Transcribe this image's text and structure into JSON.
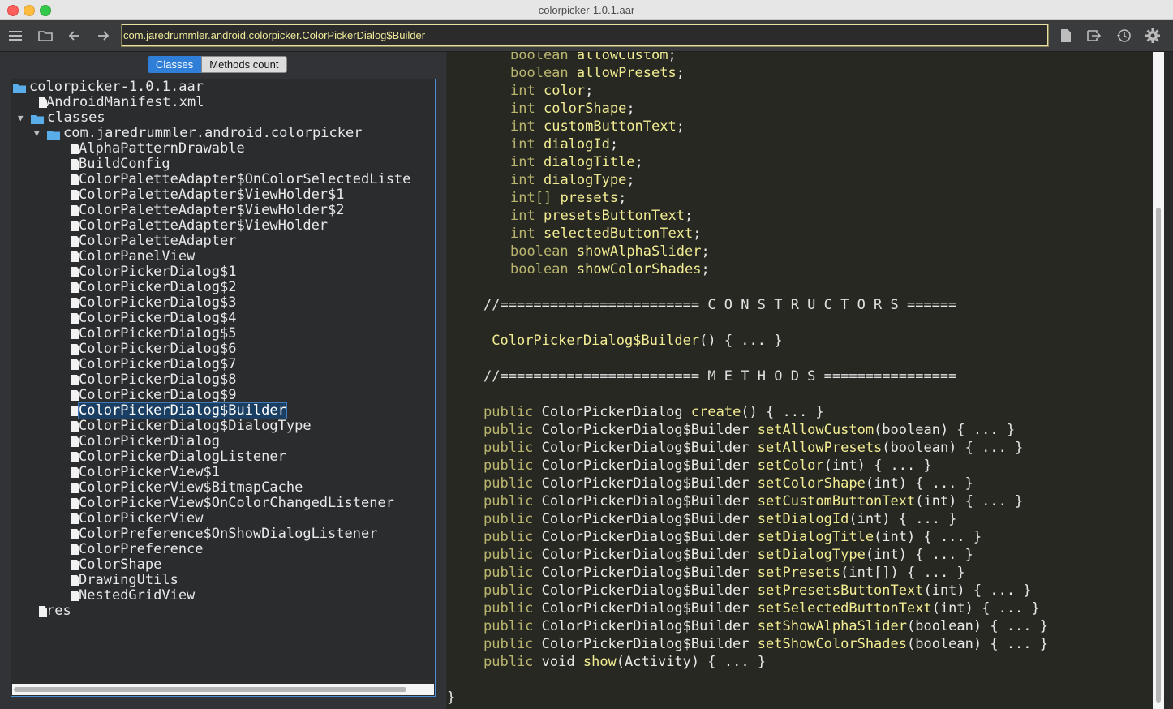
{
  "window": {
    "title": "colorpicker-1.0.1.aar"
  },
  "toolbar": {
    "address": "com.jaredrummler.android.colorpicker.ColorPickerDialog$Builder"
  },
  "tabs": {
    "classes": "Classes",
    "methods_count": "Methods count"
  },
  "tree": [
    {
      "label": "colorpicker-1.0.1.aar",
      "depth": 0,
      "kind": "folder",
      "arrow": ""
    },
    {
      "label": "AndroidManifest.xml",
      "depth": 1,
      "kind": "file",
      "arrow": ""
    },
    {
      "label": "classes",
      "depth": 1,
      "kind": "folder",
      "arrow": "▼"
    },
    {
      "label": "com.jaredrummler.android.colorpicker",
      "depth": 2,
      "kind": "folder",
      "arrow": "▼"
    },
    {
      "label": "AlphaPatternDrawable",
      "depth": 3,
      "kind": "file",
      "arrow": ""
    },
    {
      "label": "BuildConfig",
      "depth": 3,
      "kind": "file",
      "arrow": ""
    },
    {
      "label": "ColorPaletteAdapter$OnColorSelectedListe",
      "depth": 3,
      "kind": "file",
      "arrow": ""
    },
    {
      "label": "ColorPaletteAdapter$ViewHolder$1",
      "depth": 3,
      "kind": "file",
      "arrow": ""
    },
    {
      "label": "ColorPaletteAdapter$ViewHolder$2",
      "depth": 3,
      "kind": "file",
      "arrow": ""
    },
    {
      "label": "ColorPaletteAdapter$ViewHolder",
      "depth": 3,
      "kind": "file",
      "arrow": ""
    },
    {
      "label": "ColorPaletteAdapter",
      "depth": 3,
      "kind": "file",
      "arrow": ""
    },
    {
      "label": "ColorPanelView",
      "depth": 3,
      "kind": "file",
      "arrow": ""
    },
    {
      "label": "ColorPickerDialog$1",
      "depth": 3,
      "kind": "file",
      "arrow": ""
    },
    {
      "label": "ColorPickerDialog$2",
      "depth": 3,
      "kind": "file",
      "arrow": ""
    },
    {
      "label": "ColorPickerDialog$3",
      "depth": 3,
      "kind": "file",
      "arrow": ""
    },
    {
      "label": "ColorPickerDialog$4",
      "depth": 3,
      "kind": "file",
      "arrow": ""
    },
    {
      "label": "ColorPickerDialog$5",
      "depth": 3,
      "kind": "file",
      "arrow": ""
    },
    {
      "label": "ColorPickerDialog$6",
      "depth": 3,
      "kind": "file",
      "arrow": ""
    },
    {
      "label": "ColorPickerDialog$7",
      "depth": 3,
      "kind": "file",
      "arrow": ""
    },
    {
      "label": "ColorPickerDialog$8",
      "depth": 3,
      "kind": "file",
      "arrow": ""
    },
    {
      "label": "ColorPickerDialog$9",
      "depth": 3,
      "kind": "file",
      "arrow": ""
    },
    {
      "label": "ColorPickerDialog$Builder",
      "depth": 3,
      "kind": "file",
      "arrow": "",
      "selected": true
    },
    {
      "label": "ColorPickerDialog$DialogType",
      "depth": 3,
      "kind": "file",
      "arrow": ""
    },
    {
      "label": "ColorPickerDialog",
      "depth": 3,
      "kind": "file",
      "arrow": ""
    },
    {
      "label": "ColorPickerDialogListener",
      "depth": 3,
      "kind": "file",
      "arrow": ""
    },
    {
      "label": "ColorPickerView$1",
      "depth": 3,
      "kind": "file",
      "arrow": ""
    },
    {
      "label": "ColorPickerView$BitmapCache",
      "depth": 3,
      "kind": "file",
      "arrow": ""
    },
    {
      "label": "ColorPickerView$OnColorChangedListener",
      "depth": 3,
      "kind": "file",
      "arrow": ""
    },
    {
      "label": "ColorPickerView",
      "depth": 3,
      "kind": "file",
      "arrow": ""
    },
    {
      "label": "ColorPreference$OnShowDialogListener",
      "depth": 3,
      "kind": "file",
      "arrow": ""
    },
    {
      "label": "ColorPreference",
      "depth": 3,
      "kind": "file",
      "arrow": ""
    },
    {
      "label": "ColorShape",
      "depth": 3,
      "kind": "file",
      "arrow": ""
    },
    {
      "label": "DrawingUtils",
      "depth": 3,
      "kind": "file",
      "arrow": ""
    },
    {
      "label": "NestedGridView",
      "depth": 3,
      "kind": "file",
      "arrow": ""
    },
    {
      "label": "res",
      "depth": 1,
      "kind": "file",
      "arrow": ""
    }
  ],
  "code": [
    {
      "indent": 4,
      "parts": [
        [
          "kw",
          "boolean"
        ],
        [
          "tx",
          " "
        ],
        [
          "id",
          "allowCustom"
        ],
        [
          "tx",
          ";"
        ]
      ]
    },
    {
      "indent": 4,
      "parts": [
        [
          "kw",
          "boolean"
        ],
        [
          "tx",
          " "
        ],
        [
          "id",
          "allowPresets"
        ],
        [
          "tx",
          ";"
        ]
      ]
    },
    {
      "indent": 4,
      "parts": [
        [
          "kw",
          "int"
        ],
        [
          "tx",
          " "
        ],
        [
          "id",
          "color"
        ],
        [
          "tx",
          ";"
        ]
      ]
    },
    {
      "indent": 4,
      "parts": [
        [
          "kw",
          "int"
        ],
        [
          "tx",
          " "
        ],
        [
          "id",
          "colorShape"
        ],
        [
          "tx",
          ";"
        ]
      ]
    },
    {
      "indent": 4,
      "parts": [
        [
          "kw",
          "int"
        ],
        [
          "tx",
          " "
        ],
        [
          "id",
          "customButtonText"
        ],
        [
          "tx",
          ";"
        ]
      ]
    },
    {
      "indent": 4,
      "parts": [
        [
          "kw",
          "int"
        ],
        [
          "tx",
          " "
        ],
        [
          "id",
          "dialogId"
        ],
        [
          "tx",
          ";"
        ]
      ]
    },
    {
      "indent": 4,
      "parts": [
        [
          "kw",
          "int"
        ],
        [
          "tx",
          " "
        ],
        [
          "id",
          "dialogTitle"
        ],
        [
          "tx",
          ";"
        ]
      ]
    },
    {
      "indent": 4,
      "parts": [
        [
          "kw",
          "int"
        ],
        [
          "tx",
          " "
        ],
        [
          "id",
          "dialogType"
        ],
        [
          "tx",
          ";"
        ]
      ]
    },
    {
      "indent": 4,
      "parts": [
        [
          "kw",
          "int[]"
        ],
        [
          "tx",
          " "
        ],
        [
          "id",
          "presets"
        ],
        [
          "tx",
          ";"
        ]
      ]
    },
    {
      "indent": 4,
      "parts": [
        [
          "kw",
          "int"
        ],
        [
          "tx",
          " "
        ],
        [
          "id",
          "presetsButtonText"
        ],
        [
          "tx",
          ";"
        ]
      ]
    },
    {
      "indent": 4,
      "parts": [
        [
          "kw",
          "int"
        ],
        [
          "tx",
          " "
        ],
        [
          "id",
          "selectedButtonText"
        ],
        [
          "tx",
          ";"
        ]
      ]
    },
    {
      "indent": 4,
      "parts": [
        [
          "kw",
          "boolean"
        ],
        [
          "tx",
          " "
        ],
        [
          "id",
          "showAlphaSlider"
        ],
        [
          "tx",
          ";"
        ]
      ]
    },
    {
      "indent": 4,
      "parts": [
        [
          "kw",
          "boolean"
        ],
        [
          "tx",
          " "
        ],
        [
          "id",
          "showColorShades"
        ],
        [
          "tx",
          ";"
        ]
      ]
    },
    {
      "indent": 0,
      "parts": []
    },
    {
      "indent": 1,
      "parts": [
        [
          "cm",
          "//======================== C O N S T R U C T O R S ======"
        ]
      ]
    },
    {
      "indent": 0,
      "parts": []
    },
    {
      "indent": 1,
      "parts": [
        [
          "tx",
          " "
        ],
        [
          "id",
          "ColorPickerDialog$Builder"
        ],
        [
          "tx",
          "() { ... }"
        ]
      ]
    },
    {
      "indent": 0,
      "parts": []
    },
    {
      "indent": 1,
      "parts": [
        [
          "cm",
          "//======================== M E T H O D S ================"
        ]
      ]
    },
    {
      "indent": 0,
      "parts": []
    },
    {
      "indent": 1,
      "parts": [
        [
          "kw",
          "public"
        ],
        [
          "tx",
          " ColorPickerDialog "
        ],
        [
          "id",
          "create"
        ],
        [
          "tx",
          "() { ... }"
        ]
      ]
    },
    {
      "indent": 1,
      "parts": [
        [
          "kw",
          "public"
        ],
        [
          "tx",
          " ColorPickerDialog$Builder "
        ],
        [
          "id",
          "setAllowCustom"
        ],
        [
          "tx",
          "(boolean) { ... }"
        ]
      ]
    },
    {
      "indent": 1,
      "parts": [
        [
          "kw",
          "public"
        ],
        [
          "tx",
          " ColorPickerDialog$Builder "
        ],
        [
          "id",
          "setAllowPresets"
        ],
        [
          "tx",
          "(boolean) { ... }"
        ]
      ]
    },
    {
      "indent": 1,
      "parts": [
        [
          "kw",
          "public"
        ],
        [
          "tx",
          " ColorPickerDialog$Builder "
        ],
        [
          "id",
          "setColor"
        ],
        [
          "tx",
          "(int) { ... }"
        ]
      ]
    },
    {
      "indent": 1,
      "parts": [
        [
          "kw",
          "public"
        ],
        [
          "tx",
          " ColorPickerDialog$Builder "
        ],
        [
          "id",
          "setColorShape"
        ],
        [
          "tx",
          "(int) { ... }"
        ]
      ]
    },
    {
      "indent": 1,
      "parts": [
        [
          "kw",
          "public"
        ],
        [
          "tx",
          " ColorPickerDialog$Builder "
        ],
        [
          "id",
          "setCustomButtonText"
        ],
        [
          "tx",
          "(int) { ... }"
        ]
      ]
    },
    {
      "indent": 1,
      "parts": [
        [
          "kw",
          "public"
        ],
        [
          "tx",
          " ColorPickerDialog$Builder "
        ],
        [
          "id",
          "setDialogId"
        ],
        [
          "tx",
          "(int) { ... }"
        ]
      ]
    },
    {
      "indent": 1,
      "parts": [
        [
          "kw",
          "public"
        ],
        [
          "tx",
          " ColorPickerDialog$Builder "
        ],
        [
          "id",
          "setDialogTitle"
        ],
        [
          "tx",
          "(int) { ... }"
        ]
      ]
    },
    {
      "indent": 1,
      "parts": [
        [
          "kw",
          "public"
        ],
        [
          "tx",
          " ColorPickerDialog$Builder "
        ],
        [
          "id",
          "setDialogType"
        ],
        [
          "tx",
          "(int) { ... }"
        ]
      ]
    },
    {
      "indent": 1,
      "parts": [
        [
          "kw",
          "public"
        ],
        [
          "tx",
          " ColorPickerDialog$Builder "
        ],
        [
          "id",
          "setPresets"
        ],
        [
          "tx",
          "(int[]) { ... }"
        ]
      ]
    },
    {
      "indent": 1,
      "parts": [
        [
          "kw",
          "public"
        ],
        [
          "tx",
          " ColorPickerDialog$Builder "
        ],
        [
          "id",
          "setPresetsButtonText"
        ],
        [
          "tx",
          "(int) { ... }"
        ]
      ]
    },
    {
      "indent": 1,
      "parts": [
        [
          "kw",
          "public"
        ],
        [
          "tx",
          " ColorPickerDialog$Builder "
        ],
        [
          "id",
          "setSelectedButtonText"
        ],
        [
          "tx",
          "(int) { ... }"
        ]
      ]
    },
    {
      "indent": 1,
      "parts": [
        [
          "kw",
          "public"
        ],
        [
          "tx",
          " ColorPickerDialog$Builder "
        ],
        [
          "id",
          "setShowAlphaSlider"
        ],
        [
          "tx",
          "(boolean) { ... }"
        ]
      ]
    },
    {
      "indent": 1,
      "parts": [
        [
          "kw",
          "public"
        ],
        [
          "tx",
          " ColorPickerDialog$Builder "
        ],
        [
          "id",
          "setShowColorShades"
        ],
        [
          "tx",
          "(boolean) { ... }"
        ]
      ]
    },
    {
      "indent": 1,
      "parts": [
        [
          "kw",
          "public"
        ],
        [
          "tx",
          " void "
        ],
        [
          "id",
          "show"
        ],
        [
          "tx",
          "(Activity) { ... }"
        ]
      ]
    },
    {
      "indent": 0,
      "parts": []
    },
    {
      "indent": 0,
      "parts": [
        [
          "tx",
          "}"
        ]
      ]
    }
  ],
  "icons": {
    "menu": "hamburger-icon",
    "open": "folder-icon",
    "back": "arrow-left-icon",
    "forward": "arrow-right-icon",
    "save": "document-icon",
    "export": "export-icon",
    "history": "history-icon",
    "settings": "gear-icon"
  },
  "colors": {
    "accent": "#2f7fd8",
    "code_bg": "#272822",
    "identifier": "#f2ec93"
  }
}
